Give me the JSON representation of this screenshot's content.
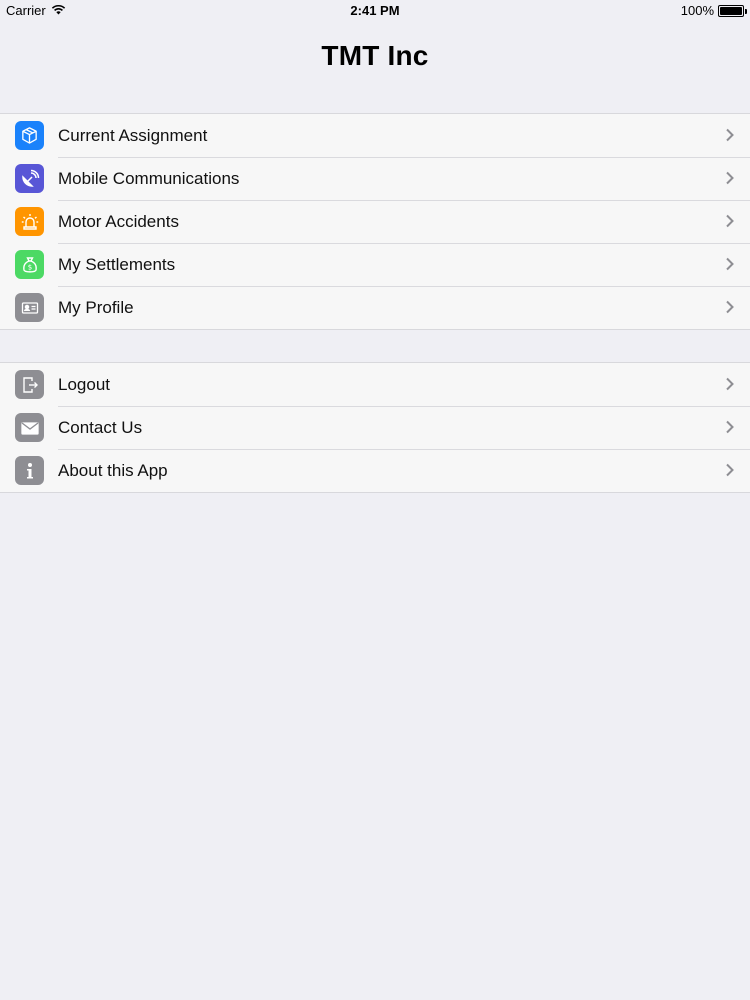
{
  "status_bar": {
    "carrier": "Carrier",
    "time": "2:41 PM",
    "battery": "100%"
  },
  "nav": {
    "title": "TMT Inc"
  },
  "menu_main": [
    {
      "label": "Current Assignment",
      "icon": "box-icon",
      "color": "#1a82fb"
    },
    {
      "label": "Mobile Communications",
      "icon": "satellite-dish-icon",
      "color": "#5856d6"
    },
    {
      "label": "Motor Accidents",
      "icon": "siren-icon",
      "color": "#ff9500"
    },
    {
      "label": "My Settlements",
      "icon": "money-bag-icon",
      "color": "#4cd964"
    },
    {
      "label": "My Profile",
      "icon": "id-card-icon",
      "color": "#8e8e93"
    }
  ],
  "menu_secondary": [
    {
      "label": "Logout",
      "icon": "logout-icon",
      "color": "#8e8e93"
    },
    {
      "label": "Contact Us",
      "icon": "envelope-icon",
      "color": "#8e8e93"
    },
    {
      "label": "About this App",
      "icon": "info-icon",
      "color": "#8e8e93"
    }
  ]
}
